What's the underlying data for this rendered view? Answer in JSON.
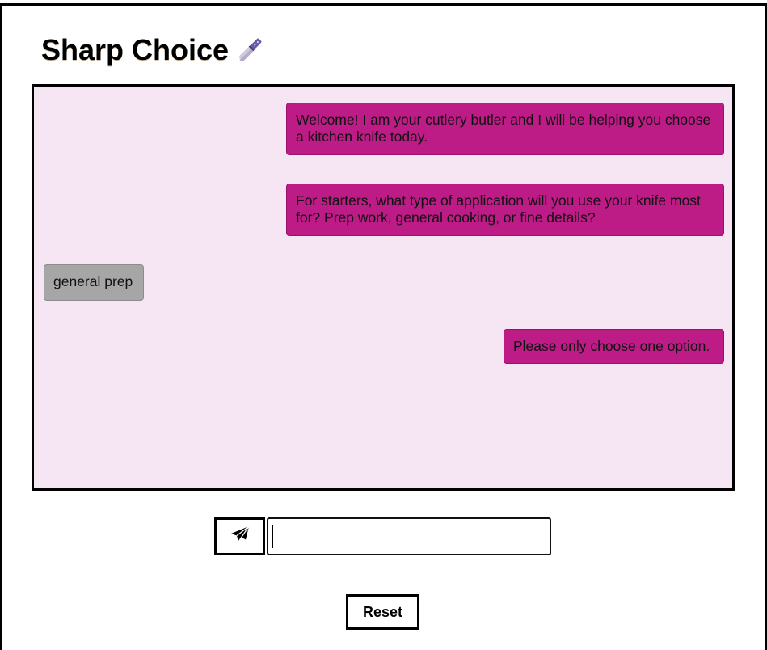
{
  "app": {
    "title": "Sharp Choice",
    "title_icon": "kitchen-knife-icon"
  },
  "chat": {
    "background": "#f6e6f3",
    "bot_color": "#bd1b86",
    "user_color": "#a7a6a7",
    "messages": [
      {
        "sender": "bot",
        "text": "Welcome! I am your cutlery butler and I will be helping you choose a kitchen knife today."
      },
      {
        "sender": "bot",
        "text": "For starters, what type of application will you use your knife most for? Prep work, general cooking, or fine details?"
      },
      {
        "sender": "user",
        "text": "general prep"
      },
      {
        "sender": "bot",
        "text": "Please only choose one option."
      }
    ]
  },
  "composer": {
    "send_icon": "paper-plane-icon",
    "input_value": "",
    "input_placeholder": ""
  },
  "controls": {
    "reset_label": "Reset"
  }
}
